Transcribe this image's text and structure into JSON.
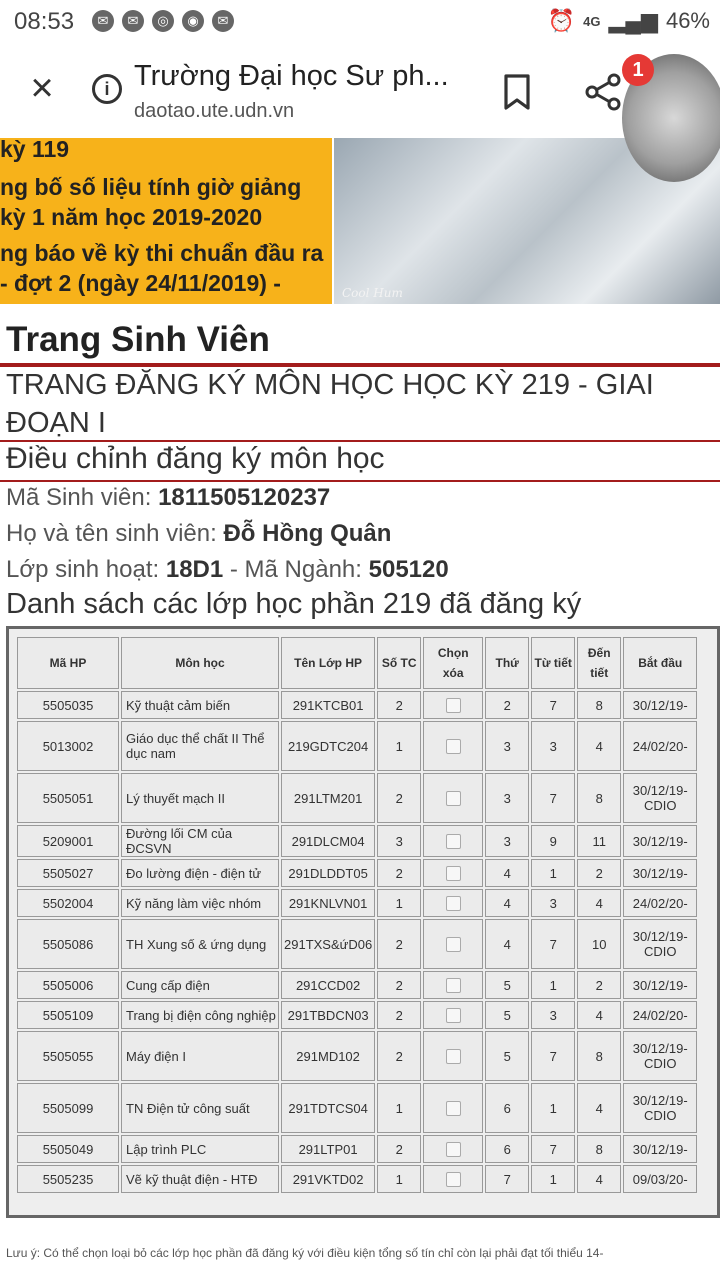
{
  "status_bar": {
    "time": "08:53",
    "network": "4G",
    "battery": "46%"
  },
  "toolbar": {
    "title": "Trường Đại học Sư ph...",
    "url": "daotao.ute.udn.vn",
    "notification_count": "1"
  },
  "banner": {
    "news_lines": [
      "kỳ 119",
      "ng bố số liệu tính giờ giảng",
      "kỳ 1 năm học 2019-2020",
      "ng báo về kỳ thi chuẩn đầu ra",
      "- đợt 2 (ngày 24/11/2019) -"
    ],
    "photo_signature": "Cool Hum"
  },
  "page": {
    "heading": "Trang Sinh Viên",
    "registration_title": "TRANG ĐĂNG KÝ MÔN HỌC HỌC KỲ 219 - GIAI ĐOẠN I",
    "adjust_title": "Điều chỉnh đăng ký môn học",
    "student_id_label": "Mã Sinh viên: ",
    "student_id": "1811505120237",
    "student_name_label": "Họ và tên sinh viên: ",
    "student_name": "Đỗ Hồng Quân",
    "class_label": "Lớp sinh hoạt: ",
    "class_value": "18D1",
    "major_label": " - Mã Ngành: ",
    "major_value": "505120",
    "list_title": "Danh sách các lớp học phần 219 đã đăng ký",
    "footnote": "Lưu ý: Có thể chọn loại bỏ các lớp học phần đã đăng ký với điều kiện tổng số tín chỉ còn lại phải đạt tối thiểu 14-"
  },
  "table": {
    "headers": [
      "Mã HP",
      "Môn học",
      "Tên Lớp HP",
      "Số TC",
      "Chọn xóa",
      "Thứ",
      "Từ tiết",
      "Đến tiết",
      "Bắt đầu"
    ],
    "rows": [
      [
        "5505035",
        "Kỹ thuật cảm biến",
        "291KTCB01",
        "2",
        "2",
        "7",
        "8",
        "30/12/19-"
      ],
      [
        "5013002",
        "Giáo dục thể chất II Thể dục nam",
        "219GDTC204",
        "1",
        "3",
        "3",
        "4",
        "24/02/20-"
      ],
      [
        "5505051",
        "Lý thuyết mạch II",
        "291LTM201",
        "2",
        "3",
        "7",
        "8",
        "30/12/19- CDIO"
      ],
      [
        "5209001",
        "Đường lối CM của ĐCSVN",
        "291DLCM04",
        "3",
        "3",
        "9",
        "11",
        "30/12/19-"
      ],
      [
        "5505027",
        "Đo lường điện - điện tử",
        "291DLDDT05",
        "2",
        "4",
        "1",
        "2",
        "30/12/19-"
      ],
      [
        "5502004",
        "Kỹ năng làm việc nhóm",
        "291KNLVN01",
        "1",
        "4",
        "3",
        "4",
        "24/02/20-"
      ],
      [
        "5505086",
        "TH Xung số & ứng dụng",
        "291TXS&ứD06",
        "2",
        "4",
        "7",
        "10",
        "30/12/19- CDIO"
      ],
      [
        "5505006",
        "Cung cấp điện",
        "291CCD02",
        "2",
        "5",
        "1",
        "2",
        "30/12/19-"
      ],
      [
        "5505109",
        "Trang bị điện công nghiệp",
        "291TBDCN03",
        "2",
        "5",
        "3",
        "4",
        "24/02/20-"
      ],
      [
        "5505055",
        "Máy điện I",
        "291MD102",
        "2",
        "5",
        "7",
        "8",
        "30/12/19- CDIO"
      ],
      [
        "5505099",
        "TN Điện tử công suất",
        "291TDTCS04",
        "1",
        "6",
        "1",
        "4",
        "30/12/19- CDIO"
      ],
      [
        "5505049",
        "Lập trình PLC",
        "291LTP01",
        "2",
        "6",
        "7",
        "8",
        "30/12/19-"
      ],
      [
        "5505235",
        "Vẽ kỹ thuật điện - HTĐ",
        "291VKTD02",
        "1",
        "7",
        "1",
        "4",
        "09/03/20-"
      ]
    ]
  }
}
